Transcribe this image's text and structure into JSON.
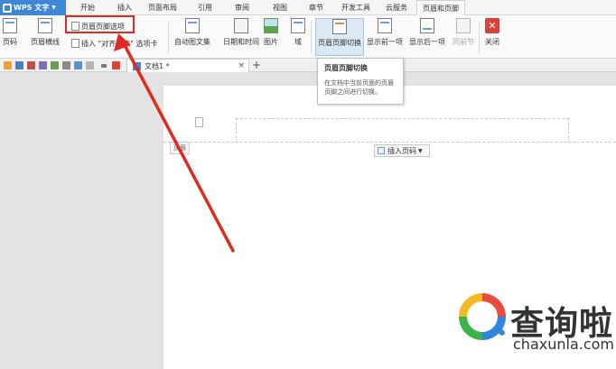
{
  "app": {
    "name": "WPS 文字"
  },
  "menu": {
    "tabs": [
      "开始",
      "插入",
      "页面布局",
      "引用",
      "审阅",
      "视图",
      "章节",
      "开发工具",
      "云服务",
      "页眉和页脚"
    ],
    "active_tab": "页眉和页脚"
  },
  "ribbon": {
    "page_number": "页码",
    "header_line": "页眉横线",
    "header_footer_options": "页眉页脚选项",
    "insert_align_tab": "插入 \"对齐制表\" 选项卡",
    "auto_text": "自动图文集",
    "date_time": "日期和时间",
    "picture": "图片",
    "field": "域",
    "switch": "页眉页脚切换",
    "show_prev": "显示前一项",
    "show_next": "显示后一项",
    "same_as_previous": "同前节",
    "close": "关闭"
  },
  "tooltip": {
    "title": "页眉页脚切换",
    "body": "在文档中当前页面的页眉页脚之间进行切换。"
  },
  "document": {
    "tab_title": "文档1 *",
    "close_glyph": "×",
    "new_tab_glyph": "+",
    "header_label": "页眉",
    "insert_page_number": "插入页码"
  },
  "watermark": {
    "brand": "查询啦",
    "url": "chaxunla.com"
  },
  "colors": {
    "app_blue": "#3e86d7",
    "annotation_red": "#e02a1f"
  }
}
